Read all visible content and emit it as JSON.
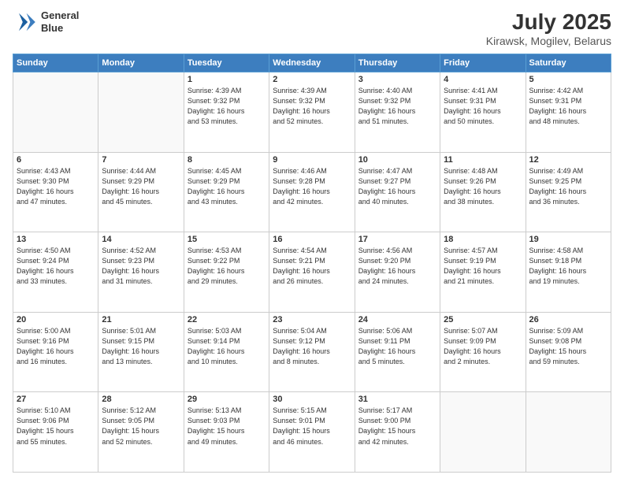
{
  "header": {
    "logo_line1": "General",
    "logo_line2": "Blue",
    "month": "July 2025",
    "location": "Kirawsk, Mogilev, Belarus"
  },
  "days_of_week": [
    "Sunday",
    "Monday",
    "Tuesday",
    "Wednesday",
    "Thursday",
    "Friday",
    "Saturday"
  ],
  "weeks": [
    [
      {
        "day": "",
        "info": ""
      },
      {
        "day": "",
        "info": ""
      },
      {
        "day": "1",
        "info": "Sunrise: 4:39 AM\nSunset: 9:32 PM\nDaylight: 16 hours\nand 53 minutes."
      },
      {
        "day": "2",
        "info": "Sunrise: 4:39 AM\nSunset: 9:32 PM\nDaylight: 16 hours\nand 52 minutes."
      },
      {
        "day": "3",
        "info": "Sunrise: 4:40 AM\nSunset: 9:32 PM\nDaylight: 16 hours\nand 51 minutes."
      },
      {
        "day": "4",
        "info": "Sunrise: 4:41 AM\nSunset: 9:31 PM\nDaylight: 16 hours\nand 50 minutes."
      },
      {
        "day": "5",
        "info": "Sunrise: 4:42 AM\nSunset: 9:31 PM\nDaylight: 16 hours\nand 48 minutes."
      }
    ],
    [
      {
        "day": "6",
        "info": "Sunrise: 4:43 AM\nSunset: 9:30 PM\nDaylight: 16 hours\nand 47 minutes."
      },
      {
        "day": "7",
        "info": "Sunrise: 4:44 AM\nSunset: 9:29 PM\nDaylight: 16 hours\nand 45 minutes."
      },
      {
        "day": "8",
        "info": "Sunrise: 4:45 AM\nSunset: 9:29 PM\nDaylight: 16 hours\nand 43 minutes."
      },
      {
        "day": "9",
        "info": "Sunrise: 4:46 AM\nSunset: 9:28 PM\nDaylight: 16 hours\nand 42 minutes."
      },
      {
        "day": "10",
        "info": "Sunrise: 4:47 AM\nSunset: 9:27 PM\nDaylight: 16 hours\nand 40 minutes."
      },
      {
        "day": "11",
        "info": "Sunrise: 4:48 AM\nSunset: 9:26 PM\nDaylight: 16 hours\nand 38 minutes."
      },
      {
        "day": "12",
        "info": "Sunrise: 4:49 AM\nSunset: 9:25 PM\nDaylight: 16 hours\nand 36 minutes."
      }
    ],
    [
      {
        "day": "13",
        "info": "Sunrise: 4:50 AM\nSunset: 9:24 PM\nDaylight: 16 hours\nand 33 minutes."
      },
      {
        "day": "14",
        "info": "Sunrise: 4:52 AM\nSunset: 9:23 PM\nDaylight: 16 hours\nand 31 minutes."
      },
      {
        "day": "15",
        "info": "Sunrise: 4:53 AM\nSunset: 9:22 PM\nDaylight: 16 hours\nand 29 minutes."
      },
      {
        "day": "16",
        "info": "Sunrise: 4:54 AM\nSunset: 9:21 PM\nDaylight: 16 hours\nand 26 minutes."
      },
      {
        "day": "17",
        "info": "Sunrise: 4:56 AM\nSunset: 9:20 PM\nDaylight: 16 hours\nand 24 minutes."
      },
      {
        "day": "18",
        "info": "Sunrise: 4:57 AM\nSunset: 9:19 PM\nDaylight: 16 hours\nand 21 minutes."
      },
      {
        "day": "19",
        "info": "Sunrise: 4:58 AM\nSunset: 9:18 PM\nDaylight: 16 hours\nand 19 minutes."
      }
    ],
    [
      {
        "day": "20",
        "info": "Sunrise: 5:00 AM\nSunset: 9:16 PM\nDaylight: 16 hours\nand 16 minutes."
      },
      {
        "day": "21",
        "info": "Sunrise: 5:01 AM\nSunset: 9:15 PM\nDaylight: 16 hours\nand 13 minutes."
      },
      {
        "day": "22",
        "info": "Sunrise: 5:03 AM\nSunset: 9:14 PM\nDaylight: 16 hours\nand 10 minutes."
      },
      {
        "day": "23",
        "info": "Sunrise: 5:04 AM\nSunset: 9:12 PM\nDaylight: 16 hours\nand 8 minutes."
      },
      {
        "day": "24",
        "info": "Sunrise: 5:06 AM\nSunset: 9:11 PM\nDaylight: 16 hours\nand 5 minutes."
      },
      {
        "day": "25",
        "info": "Sunrise: 5:07 AM\nSunset: 9:09 PM\nDaylight: 16 hours\nand 2 minutes."
      },
      {
        "day": "26",
        "info": "Sunrise: 5:09 AM\nSunset: 9:08 PM\nDaylight: 15 hours\nand 59 minutes."
      }
    ],
    [
      {
        "day": "27",
        "info": "Sunrise: 5:10 AM\nSunset: 9:06 PM\nDaylight: 15 hours\nand 55 minutes."
      },
      {
        "day": "28",
        "info": "Sunrise: 5:12 AM\nSunset: 9:05 PM\nDaylight: 15 hours\nand 52 minutes."
      },
      {
        "day": "29",
        "info": "Sunrise: 5:13 AM\nSunset: 9:03 PM\nDaylight: 15 hours\nand 49 minutes."
      },
      {
        "day": "30",
        "info": "Sunrise: 5:15 AM\nSunset: 9:01 PM\nDaylight: 15 hours\nand 46 minutes."
      },
      {
        "day": "31",
        "info": "Sunrise: 5:17 AM\nSunset: 9:00 PM\nDaylight: 15 hours\nand 42 minutes."
      },
      {
        "day": "",
        "info": ""
      },
      {
        "day": "",
        "info": ""
      }
    ]
  ]
}
